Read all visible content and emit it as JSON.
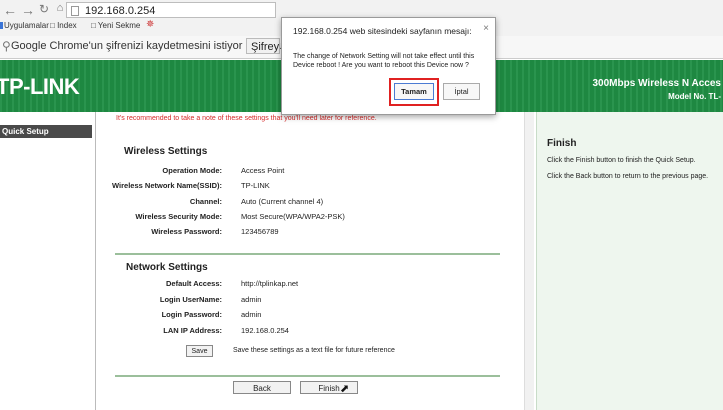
{
  "browser": {
    "url": "192.168.0.254",
    "bookmarks": [
      "Uygulamalar",
      "Index",
      "Yeni Sekme"
    ]
  },
  "password_bar": {
    "message": "Google Chrome'un şifrenizi kaydetmesini istiyor musunuz?",
    "save_button": "Şifreyi kaydet"
  },
  "header": {
    "logo": "TP-LINK",
    "product": "300Mbps Wireless N Acces",
    "model": "Model No. TL-"
  },
  "menu": {
    "active_item": "Quick Setup"
  },
  "main": {
    "warning": "It's recommended to take a note of these settings that you'll need later for reference.",
    "wireless": {
      "title": "Wireless Settings",
      "rows": [
        {
          "label": "Operation Mode:",
          "value": "Access Point"
        },
        {
          "label": "Wireless Network Name(SSID):",
          "value": "TP-LINK"
        },
        {
          "label": "Channel:",
          "value": "Auto (Current channel 4)"
        },
        {
          "label": "Wireless Security Mode:",
          "value": "Most Secure(WPA/WPA2-PSK)"
        },
        {
          "label": "Wireless Password:",
          "value": "123456789"
        }
      ]
    },
    "network": {
      "title": "Network Settings",
      "rows": [
        {
          "label": "Default Access:",
          "value": "http://tplinkap.net"
        },
        {
          "label": "Login UserName:",
          "value": "admin"
        },
        {
          "label": "Login Password:",
          "value": "admin"
        },
        {
          "label": "LAN IP Address:",
          "value": "192.168.0.254"
        }
      ]
    },
    "save_button": "Save",
    "save_note": "Save these settings as a text file for future reference",
    "back_button": "Back",
    "finish_button": "Finish"
  },
  "help": {
    "title": "Finish",
    "line1": "Click the Finish button to finish the Quick Setup.",
    "line2": "Click the Back button to return to the previous page."
  },
  "dialog": {
    "title": "192.168.0.254 web sitesindeki sayfanın mesajı:",
    "message": "The change of Network Setting will not take effect until this Device reboot ! Are you want to reboot this Device now ?",
    "ok_button": "Tamam",
    "cancel_button": "İptal"
  },
  "colors": {
    "header_green": "#1f8e44",
    "warning_red": "#d62b2b",
    "highlight_red": "#e02121",
    "help_bg": "#eef6ee"
  }
}
